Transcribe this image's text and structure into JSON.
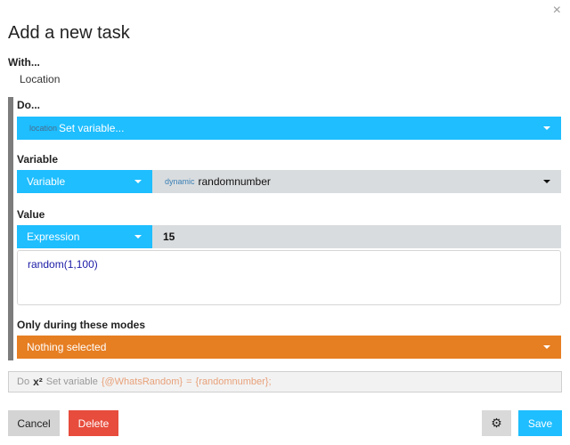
{
  "dialog": {
    "title": "Add a new task",
    "close_glyph": "×"
  },
  "with": {
    "label": "With...",
    "value": "Location"
  },
  "do": {
    "label": "Do...",
    "action_prefix": "location",
    "action_label": "Set variable..."
  },
  "variable": {
    "label": "Variable",
    "type": "Variable",
    "name_prefix": "dynamic",
    "name": "randomnumber"
  },
  "value": {
    "label": "Value",
    "type": "Expression",
    "preview": "15",
    "expression_fn": "random",
    "expression_open": "(",
    "expression_a": "1",
    "expression_sep": ",",
    "expression_b": "100",
    "expression_close": ")"
  },
  "modes": {
    "label": "Only during these modes",
    "selected": "Nothing selected"
  },
  "summary": {
    "prefix": "Do",
    "icon_text": "x²",
    "action": "Set variable",
    "var_ref": "{@WhatsRandom}",
    "equals": "=",
    "value_ref": "{randomnumber};"
  },
  "footer": {
    "cancel_label": "Cancel",
    "delete_label": "Delete",
    "gear_icon": "⚙",
    "save_label": "Save"
  },
  "colors": {
    "accent": "#1ebeff",
    "danger": "#e74c3c",
    "modes": "#e67e22",
    "do_border": "#7c7c7c"
  }
}
